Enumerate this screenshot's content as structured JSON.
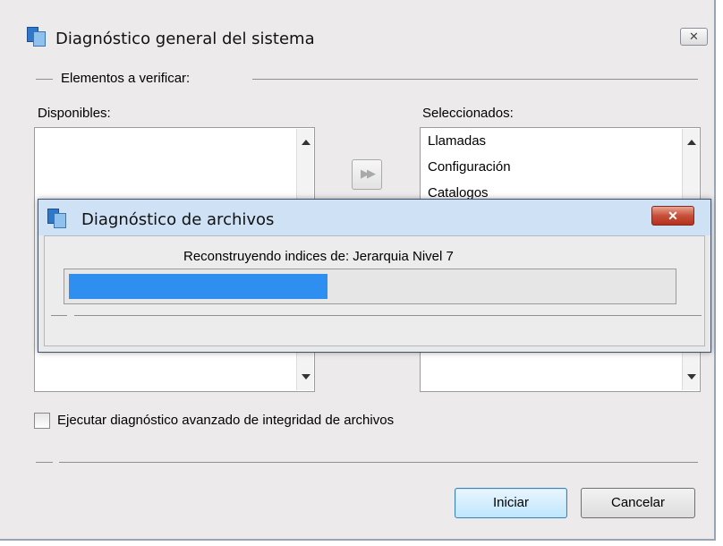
{
  "window": {
    "title": "Diagnóstico general del sistema",
    "close_label": "✕"
  },
  "group": {
    "legend": "Elementos a verificar:"
  },
  "available": {
    "label": "Disponibles:",
    "items": []
  },
  "selected": {
    "label": "Seleccionados:",
    "items": [
      "Llamadas",
      "Configuración",
      "Catalogos"
    ]
  },
  "move_button": {
    "label": "▶▶"
  },
  "advanced_checkbox": {
    "label": "Ejecutar diagnóstico avanzado de integridad de archivos",
    "checked": false
  },
  "buttons": {
    "start": "Iniciar",
    "cancel": "Cancelar"
  },
  "progress_dialog": {
    "title": "Diagnóstico de archivos",
    "close_label": "✕",
    "status": "Reconstruyendo indices de: Jerarquia Nivel 7",
    "progress": 0.43,
    "bar_color": "#2f8ff0"
  }
}
